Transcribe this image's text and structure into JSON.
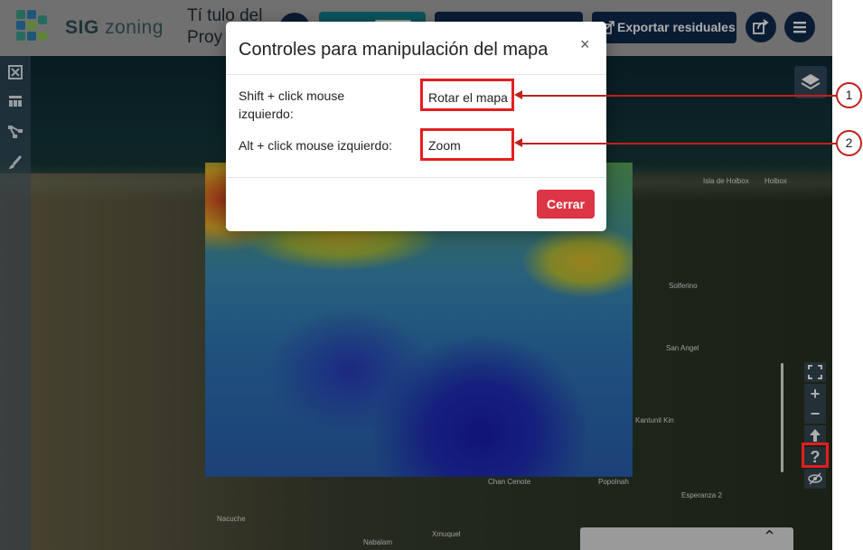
{
  "header": {
    "brand_bold": "SIG",
    "brand_light": "zoning",
    "project_title": "Tí tulo del Proy",
    "export_label": "Exportar residuales"
  },
  "map": {
    "places": [
      "Isla de Holbox",
      "Holbox",
      "Solferino",
      "San Angel",
      "Kantunil Kin",
      "Esperanza 2",
      "Chan Cenote",
      "Popolnah",
      "Nacuche",
      "Xmuquel",
      "Nabalam"
    ]
  },
  "modal": {
    "title": "Controles para manipulación del mapa",
    "close": "×",
    "rows": [
      {
        "label": "Shift + click mouse izquierdo:",
        "value": "Rotar el mapa"
      },
      {
        "label": "Alt + click mouse izquierdo:",
        "value": "Zoom"
      }
    ],
    "close_button": "Cerrar"
  },
  "annotations": [
    "1",
    "2"
  ],
  "controls": {
    "help": "?",
    "zoom_in": "+",
    "zoom_out": "−"
  },
  "colors": {
    "accent": "#102a4c",
    "teal": "#127b87",
    "danger": "#dc3545",
    "highlight": "#e41e1e"
  }
}
